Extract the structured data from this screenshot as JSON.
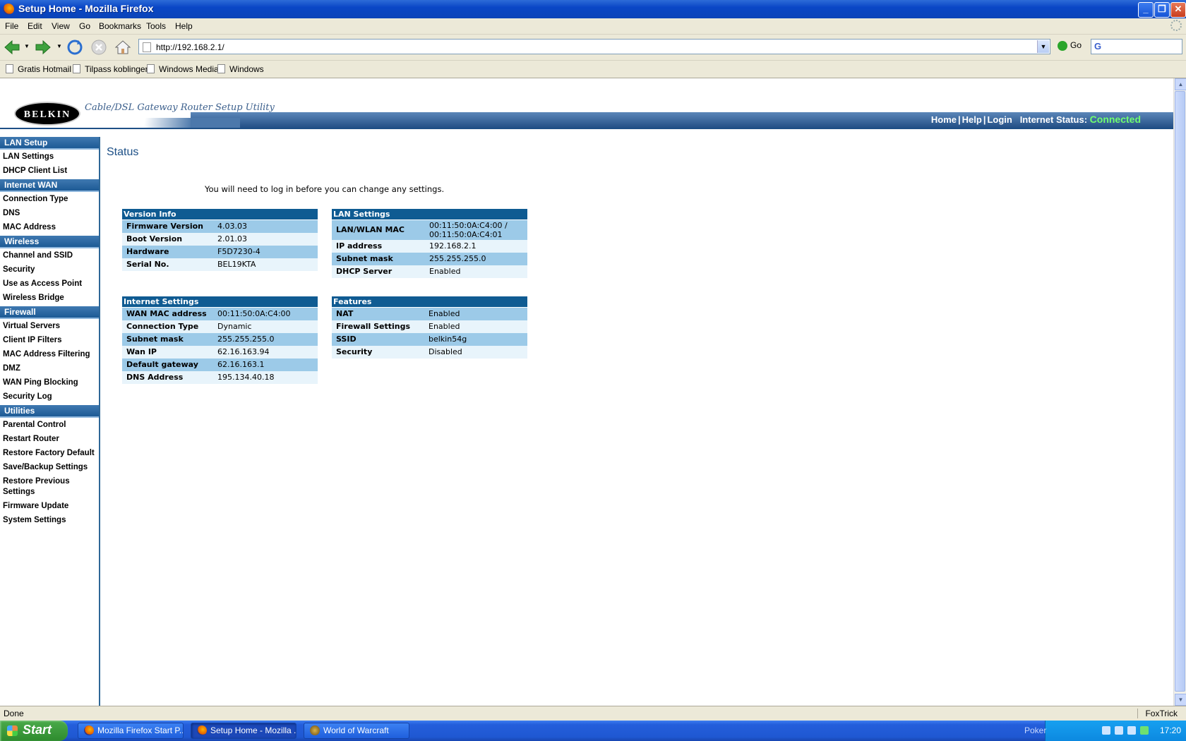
{
  "window": {
    "title": "Setup Home - Mozilla Firefox"
  },
  "menu": [
    "File",
    "Edit",
    "View",
    "Go",
    "Bookmarks",
    "Tools",
    "Help"
  ],
  "address": {
    "url": "http://192.168.2.1/",
    "go_label": "Go"
  },
  "bookmarks": [
    "Gratis Hotmail",
    "Tilpass koblinger",
    "Windows Media",
    "Windows"
  ],
  "header": {
    "brand": "BELKIN",
    "subtitle": "Cable/DSL Gateway Router Setup Utility",
    "links": {
      "home": "Home",
      "help": "Help",
      "login": "Login"
    },
    "status_label": "Internet Status:",
    "status_value": "Connected"
  },
  "sidebar": {
    "lan_setup": {
      "title": "LAN Setup",
      "items": [
        "LAN Settings",
        "DHCP Client List"
      ]
    },
    "internet_wan": {
      "title": "Internet WAN",
      "items": [
        "Connection Type",
        "DNS",
        "MAC Address"
      ]
    },
    "wireless": {
      "title": "Wireless",
      "items": [
        "Channel and SSID",
        "Security",
        "Use as Access Point",
        "Wireless Bridge"
      ]
    },
    "firewall": {
      "title": "Firewall",
      "items": [
        "Virtual Servers",
        "Client IP Filters",
        "MAC Address Filtering",
        "DMZ",
        "WAN Ping Blocking",
        "Security Log"
      ]
    },
    "utilities": {
      "title": "Utilities",
      "items": [
        "Parental Control",
        "Restart Router",
        "Restore Factory Default",
        "Save/Backup Settings",
        "Restore Previous Settings",
        "Firmware Update",
        "System Settings"
      ]
    }
  },
  "main": {
    "title": "Status",
    "notice": "You will need to log in before you can change any settings.",
    "version_info": {
      "title": "Version Info",
      "rows": [
        [
          "Firmware Version",
          "4.03.03"
        ],
        [
          "Boot Version",
          "2.01.03"
        ],
        [
          "Hardware",
          "F5D7230-4"
        ],
        [
          "Serial No.",
          "BEL19KTA"
        ]
      ]
    },
    "lan_settings": {
      "title": "LAN Settings",
      "rows": [
        [
          "LAN/WLAN MAC",
          "00:11:50:0A:C4:00 /",
          "00:11:50:0A:C4:01"
        ],
        [
          "IP address",
          "192.168.2.1"
        ],
        [
          "Subnet mask",
          "255.255.255.0"
        ],
        [
          "DHCP Server",
          "Enabled"
        ]
      ]
    },
    "internet_settings": {
      "title": "Internet Settings",
      "rows": [
        [
          "WAN MAC address",
          "00:11:50:0A:C4:00"
        ],
        [
          "Connection Type",
          "Dynamic"
        ],
        [
          "Subnet mask",
          "255.255.255.0"
        ],
        [
          "Wan IP",
          "62.16.163.94"
        ],
        [
          "Default gateway",
          "62.16.163.1"
        ],
        [
          "DNS Address",
          "195.134.40.18"
        ]
      ]
    },
    "features": {
      "title": "Features",
      "rows": [
        [
          "NAT",
          "Enabled"
        ],
        [
          "Firewall Settings",
          "Enabled"
        ],
        [
          "SSID",
          "belkin54g"
        ],
        [
          "Security",
          "Disabled"
        ]
      ]
    }
  },
  "statusbar": {
    "text": "Done",
    "extension": "FoxTrick"
  },
  "taskbar": {
    "start": "Start",
    "tasks": [
      "Mozilla Firefox Start P...",
      "Setup Home - Mozilla ...",
      "World of Warcraft"
    ],
    "tray_label": "Poker",
    "clock": "17:20"
  }
}
